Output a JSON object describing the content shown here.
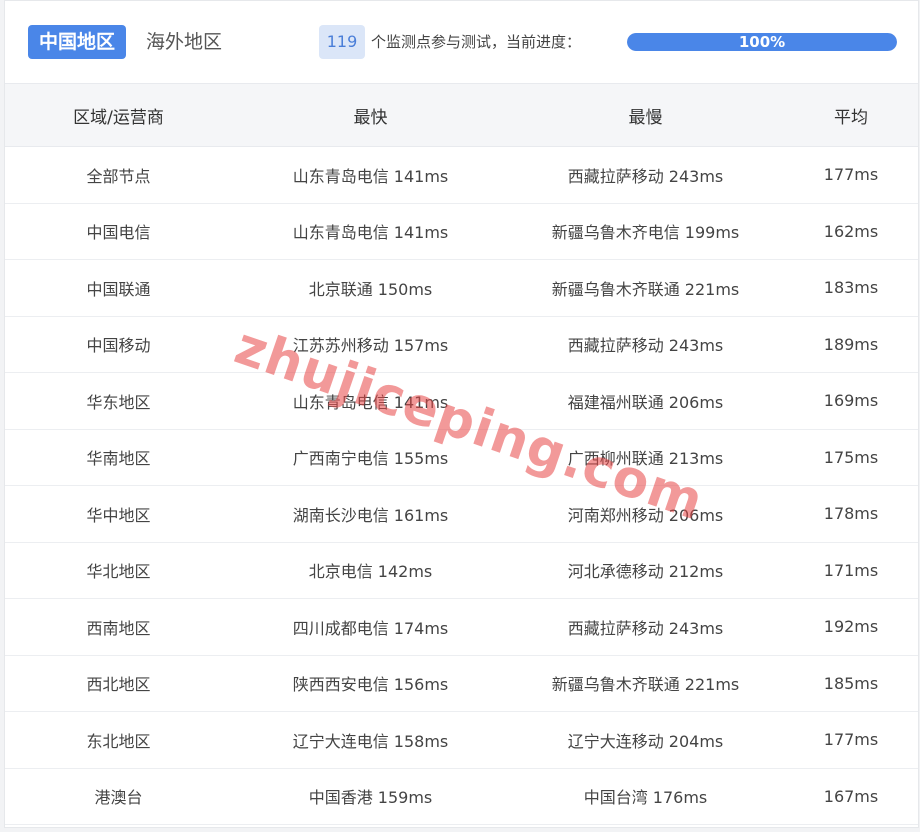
{
  "tabs": [
    {
      "label": "中国地区",
      "active": true
    },
    {
      "label": "海外地区",
      "active": false
    }
  ],
  "monitor": {
    "count": "119",
    "text": "个监测点参与测试，当前进度：",
    "progress_percent": 100,
    "progress_label": "100%"
  },
  "table": {
    "headers": [
      "区域/运营商",
      "最快",
      "最慢",
      "平均"
    ],
    "rows": [
      [
        "全部节点",
        "山东青岛电信 141ms",
        "西藏拉萨移动 243ms",
        "177ms"
      ],
      [
        "中国电信",
        "山东青岛电信 141ms",
        "新疆乌鲁木齐电信 199ms",
        "162ms"
      ],
      [
        "中国联通",
        "北京联通 150ms",
        "新疆乌鲁木齐联通 221ms",
        "183ms"
      ],
      [
        "中国移动",
        "江苏苏州移动 157ms",
        "西藏拉萨移动 243ms",
        "189ms"
      ],
      [
        "华东地区",
        "山东青岛电信 141ms",
        "福建福州联通 206ms",
        "169ms"
      ],
      [
        "华南地区",
        "广西南宁电信 155ms",
        "广西柳州联通 213ms",
        "175ms"
      ],
      [
        "华中地区",
        "湖南长沙电信 161ms",
        "河南郑州移动 206ms",
        "178ms"
      ],
      [
        "华北地区",
        "北京电信 142ms",
        "河北承德移动 212ms",
        "171ms"
      ],
      [
        "西南地区",
        "四川成都电信 174ms",
        "西藏拉萨移动 243ms",
        "192ms"
      ],
      [
        "西北地区",
        "陕西西安电信 156ms",
        "新疆乌鲁木齐联通 221ms",
        "185ms"
      ],
      [
        "东北地区",
        "辽宁大连电信 158ms",
        "辽宁大连移动 204ms",
        "177ms"
      ],
      [
        "港澳台",
        "中国香港 159ms",
        "中国台湾 176ms",
        "167ms"
      ]
    ]
  },
  "watermark": "zhujiceping.com",
  "colors": {
    "accent": "#4a86e8",
    "badge_bg": "#dbe6f8",
    "watermark": "#e84646"
  }
}
